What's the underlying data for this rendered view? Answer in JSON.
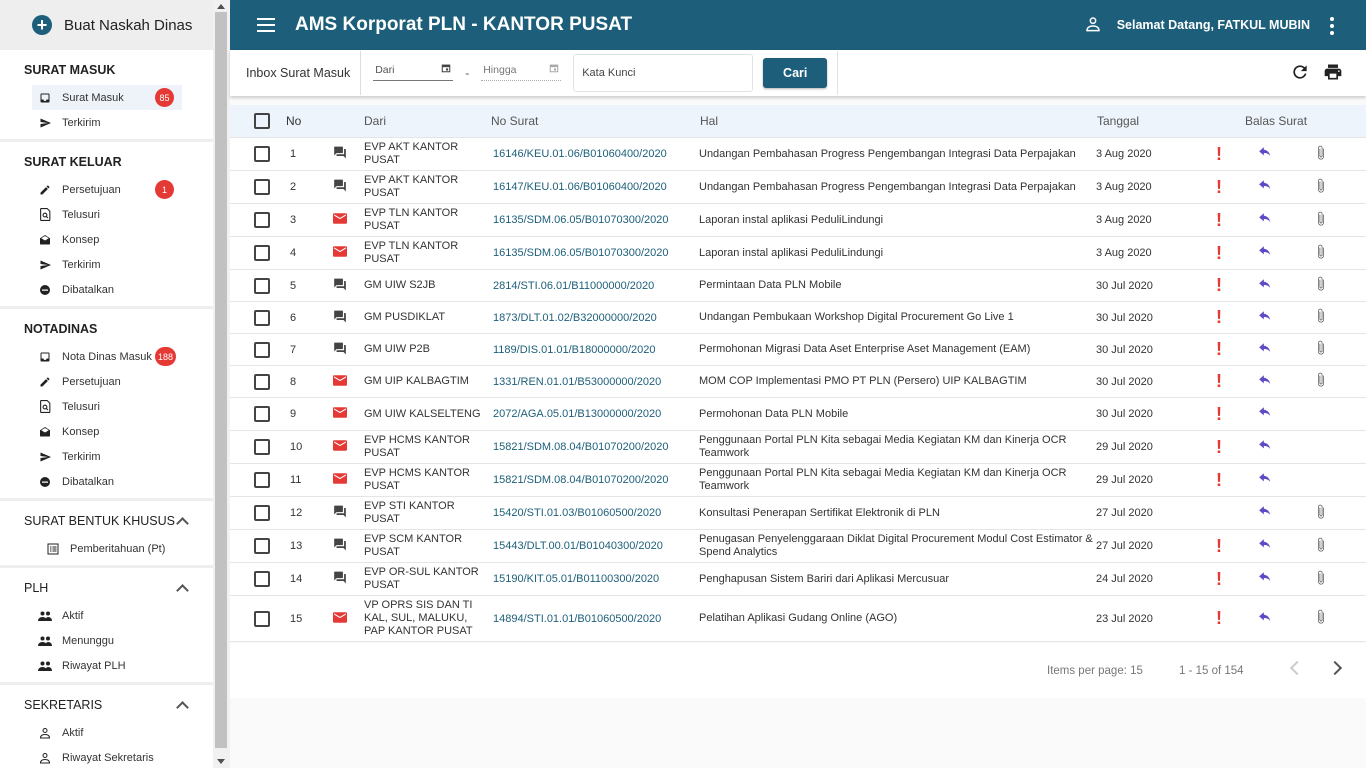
{
  "sidebar": {
    "compose_label": "Buat Naskah Dinas",
    "sections": {
      "surat_masuk": {
        "title": "SURAT MASUK",
        "items": [
          {
            "label": "Surat Masuk",
            "badge": "85"
          },
          {
            "label": "Terkirim"
          }
        ]
      },
      "surat_keluar": {
        "title": "SURAT KELUAR",
        "items": [
          {
            "label": "Persetujuan",
            "badge": "1"
          },
          {
            "label": "Telusuri"
          },
          {
            "label": "Konsep"
          },
          {
            "label": "Terkirim"
          },
          {
            "label": "Dibatalkan"
          }
        ]
      },
      "notadinas": {
        "title": "NOTADINAS",
        "items": [
          {
            "label": "Nota Dinas Masuk",
            "badge": "188"
          },
          {
            "label": "Persetujuan"
          },
          {
            "label": "Telusuri"
          },
          {
            "label": "Konsep"
          },
          {
            "label": "Terkirim"
          },
          {
            "label": "Dibatalkan"
          }
        ]
      },
      "surat_bentuk_khusus": {
        "title": "SURAT BENTUK KHUSUS",
        "items": [
          {
            "label": "Pemberitahuan (Pt)"
          }
        ]
      },
      "plh": {
        "title": "PLH",
        "items": [
          {
            "label": "Aktif"
          },
          {
            "label": "Menunggu"
          },
          {
            "label": "Riwayat PLH"
          }
        ]
      },
      "sekretaris": {
        "title": "SEKRETARIS",
        "items": [
          {
            "label": "Aktif"
          },
          {
            "label": "Riwayat Sekretaris"
          }
        ]
      }
    }
  },
  "header": {
    "title": "AMS Korporat PLN - KANTOR PUSAT",
    "greeting": "Selamat Datang, FATKUL MUBIN"
  },
  "toolbar": {
    "inbox_label": "Inbox Surat Masuk",
    "from_placeholder": "Dari",
    "separator": "-",
    "to_placeholder": "Hingga",
    "keyword_placeholder": "Kata Kunci",
    "search_button": "Cari"
  },
  "table": {
    "headers": {
      "no": "No",
      "dari": "Dari",
      "no_surat": "No Surat",
      "hal": "Hal",
      "tanggal": "Tanggal",
      "balas": "Balas Surat"
    },
    "rows": [
      {
        "no": "1",
        "icon": "chat-icon",
        "dari": "EVP AKT KANTOR PUSAT",
        "no_surat": "16146/KEU.01.06/B01060400/2020",
        "hal": "Undangan Pembahasan Progress Pengembangan Integrasi Data Perpajakan",
        "tanggal": "3 Aug 2020",
        "urgent": true,
        "attach": true
      },
      {
        "no": "2",
        "icon": "chat-icon",
        "dari": "EVP AKT KANTOR PUSAT",
        "no_surat": "16147/KEU.01.06/B01060400/2020",
        "hal": "Undangan Pembahasan Progress Pengembangan Integrasi Data Perpajakan",
        "tanggal": "3 Aug 2020",
        "urgent": true,
        "attach": true
      },
      {
        "no": "3",
        "icon": "mail-icon",
        "dari": "EVP TLN KANTOR PUSAT",
        "no_surat": "16135/SDM.06.05/B01070300/2020",
        "hal": "Laporan instal aplikasi PeduliLindungi",
        "tanggal": "3 Aug 2020",
        "urgent": true,
        "attach": true
      },
      {
        "no": "4",
        "icon": "mail-icon",
        "dari": "EVP TLN KANTOR PUSAT",
        "no_surat": "16135/SDM.06.05/B01070300/2020",
        "hal": "Laporan instal aplikasi PeduliLindungi",
        "tanggal": "3 Aug 2020",
        "urgent": true,
        "attach": true
      },
      {
        "no": "5",
        "icon": "chat-icon",
        "dari": "GM UIW S2JB",
        "no_surat": "2814/STI.06.01/B11000000/2020",
        "hal": "Permintaan Data PLN Mobile",
        "tanggal": "30 Jul 2020",
        "urgent": true,
        "attach": true
      },
      {
        "no": "6",
        "icon": "chat-icon",
        "dari": "GM PUSDIKLAT",
        "no_surat": "1873/DLT.01.02/B32000000/2020",
        "hal": "Undangan Pembukaan Workshop Digital Procurement Go Live 1",
        "tanggal": "30 Jul 2020",
        "urgent": true,
        "attach": true
      },
      {
        "no": "7",
        "icon": "chat-icon",
        "dari": "GM UIW P2B",
        "no_surat": "1189/DIS.01.01/B18000000/2020",
        "hal": "Permohonan Migrasi Data Aset Enterprise Aset Management (EAM)",
        "tanggal": "30 Jul 2020",
        "urgent": true,
        "attach": true
      },
      {
        "no": "8",
        "icon": "mail-icon",
        "dari": "GM UIP KALBAGTIM",
        "no_surat": "1331/REN.01.01/B53000000/2020",
        "hal": "MOM COP Implementasi PMO PT PLN (Persero) UIP KALBAGTIM",
        "tanggal": "30 Jul 2020",
        "urgent": true,
        "attach": true
      },
      {
        "no": "9",
        "icon": "mail-icon",
        "dari": "GM UIW KALSELTENG",
        "no_surat": "2072/AGA.05.01/B13000000/2020",
        "hal": "Permohonan Data PLN Mobile",
        "tanggal": "30 Jul 2020",
        "urgent": true,
        "attach": false
      },
      {
        "no": "10",
        "icon": "mail-icon",
        "dari": "EVP HCMS KANTOR PUSAT",
        "no_surat": "15821/SDM.08.04/B01070200/2020",
        "hal": "Penggunaan Portal PLN Kita sebagai Media Kegiatan KM dan Kinerja OCR Teamwork",
        "tanggal": "29 Jul 2020",
        "urgent": true,
        "attach": false
      },
      {
        "no": "11",
        "icon": "mail-icon",
        "dari": "EVP HCMS KANTOR PUSAT",
        "no_surat": "15821/SDM.08.04/B01070200/2020",
        "hal": "Penggunaan Portal PLN Kita sebagai Media Kegiatan KM dan Kinerja OCR Teamwork",
        "tanggal": "29 Jul 2020",
        "urgent": true,
        "attach": false
      },
      {
        "no": "12",
        "icon": "chat-icon",
        "dari": "EVP STI KANTOR PUSAT",
        "no_surat": "15420/STI.01.03/B01060500/2020",
        "hal": "Konsultasi Penerapan Sertifikat Elektronik di PLN",
        "tanggal": "27 Jul 2020",
        "urgent": false,
        "attach": true
      },
      {
        "no": "13",
        "icon": "chat-icon",
        "dari": "EVP SCM KANTOR PUSAT",
        "no_surat": "15443/DLT.00.01/B01040300/2020",
        "hal": "Penugasan Penyelenggaraan Diklat Digital Procurement Modul Cost Estimator & Spend Analytics",
        "tanggal": "27 Jul 2020",
        "urgent": true,
        "attach": true
      },
      {
        "no": "14",
        "icon": "chat-icon",
        "dari": "EVP OR-SUL KANTOR PUSAT",
        "no_surat": "15190/KIT.05.01/B01100300/2020",
        "hal": "Penghapusan Sistem Bariri dari Aplikasi Mercusuar",
        "tanggal": "24 Jul 2020",
        "urgent": true,
        "attach": true
      },
      {
        "no": "15",
        "icon": "mail-icon",
        "dari": "VP OPRS SIS DAN TI KAL, SUL, MALUKU, PAP KANTOR PUSAT",
        "no_surat": "14894/STI.01.01/B01060500/2020",
        "hal": "Pelatihan Aplikasi Gudang Online (AGO)",
        "tanggal": "23 Jul 2020",
        "urgent": true,
        "attach": true
      }
    ]
  },
  "pager": {
    "items_per_page": "Items per page: 15",
    "range": "1 - 15 of 154"
  },
  "colors": {
    "primary": "#1d5f7a",
    "badge": "#e53935",
    "reply": "#5b4bc4"
  }
}
